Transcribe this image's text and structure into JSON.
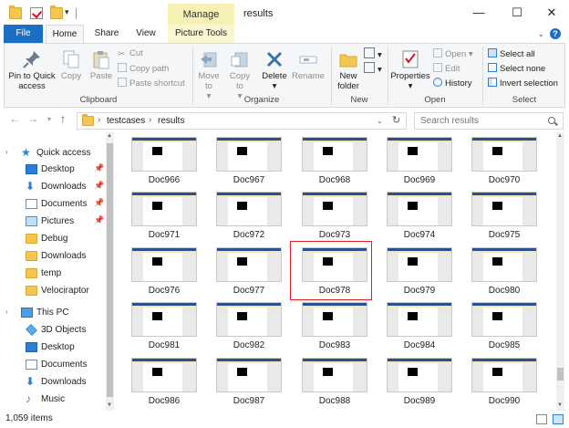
{
  "window": {
    "title": "results",
    "context_tab": "Manage",
    "minimize": "—",
    "maximize": "☐",
    "close": "✕"
  },
  "tabs": [
    "File",
    "Home",
    "Share",
    "View",
    "Picture Tools"
  ],
  "ribbon": {
    "clipboard": {
      "label": "Clipboard",
      "pin": "Pin to Quick access",
      "copy": "Copy",
      "paste": "Paste",
      "cut": "Cut",
      "copy_path": "Copy path",
      "paste_shortcut": "Paste shortcut"
    },
    "organize": {
      "label": "Organize",
      "move_to": "Move to",
      "copy_to": "Copy to",
      "delete": "Delete",
      "rename": "Rename"
    },
    "new": {
      "label": "New",
      "new_folder": "New folder"
    },
    "open": {
      "label": "Open",
      "properties": "Properties",
      "open": "Open",
      "edit": "Edit",
      "history": "History"
    },
    "select": {
      "label": "Select",
      "select_all": "Select all",
      "select_none": "Select none",
      "invert": "Invert selection"
    }
  },
  "address": {
    "crumbs": [
      "testcases",
      "results"
    ],
    "search_placeholder": "Search results"
  },
  "nav": {
    "quick_access": "Quick access",
    "pinned": [
      "Desktop",
      "Downloads",
      "Documents",
      "Pictures"
    ],
    "folders": [
      "Debug",
      "Downloads",
      "temp",
      "Velociraptor"
    ],
    "this_pc": "This PC",
    "pc_items": [
      "3D Objects",
      "Desktop",
      "Documents",
      "Downloads",
      "Music"
    ]
  },
  "files": [
    "Doc966",
    "Doc967",
    "Doc968",
    "Doc969",
    "Doc970",
    "Doc971",
    "Doc972",
    "Doc973",
    "Doc974",
    "Doc975",
    "Doc976",
    "Doc977",
    "Doc978",
    "Doc979",
    "Doc980",
    "Doc981",
    "Doc982",
    "Doc983",
    "Doc984",
    "Doc985",
    "Doc986",
    "Doc987",
    "Doc988",
    "Doc989",
    "Doc990"
  ],
  "selected_file": "Doc978",
  "status": {
    "count": "1,059 items"
  },
  "colors": {
    "accent": "#1a6fc4",
    "context_tab": "#f8f1b5",
    "selection_outline": "#e0201c"
  }
}
